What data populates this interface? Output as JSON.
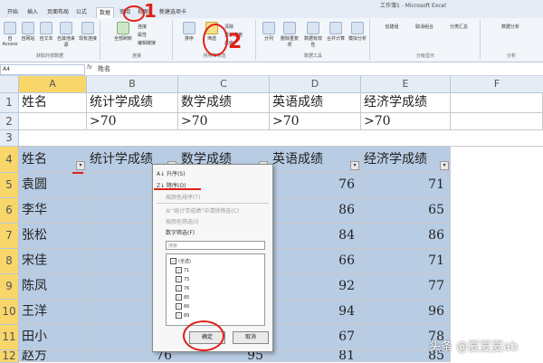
{
  "window": {
    "title": "工作簿1 - Microsoft Excel"
  },
  "tabs": [
    "开始",
    "插入",
    "页面布局",
    "公式",
    "数据",
    "审阅",
    "视图",
    "新建选项卡"
  ],
  "active_tab_index": 4,
  "ribbon": {
    "groups": [
      {
        "label": "获取外部数据",
        "buttons": [
          "自 Access",
          "自网站",
          "自文本",
          "自其他来源",
          "现有连接"
        ]
      },
      {
        "label": "连接",
        "buttons": [
          "全部刷新",
          "连接",
          "属性",
          "编辑链接"
        ]
      },
      {
        "label": "排序和筛选",
        "buttons": [
          "排序",
          "筛选",
          "清除",
          "重新应用",
          "高级"
        ]
      },
      {
        "label": "数据工具",
        "buttons": [
          "分列",
          "删除重复项",
          "数据有效性",
          "合并计算",
          "模拟分析"
        ]
      },
      {
        "label": "分级显示",
        "buttons": [
          "创建组",
          "取消组合",
          "分类汇总"
        ]
      },
      {
        "label": "分析",
        "buttons": [
          "数据分析"
        ]
      }
    ]
  },
  "formula_bar": {
    "name_box": "A4",
    "fx": "fx",
    "value": "姓名"
  },
  "columns": [
    "A",
    "B",
    "C",
    "D",
    "E",
    "F"
  ],
  "rows": [
    "1",
    "2",
    "3",
    "4",
    "5",
    "6",
    "7",
    "8",
    "9",
    "10",
    "11",
    "12"
  ],
  "criteria": {
    "headers": [
      "姓名",
      "统计学成绩",
      "数学成绩",
      "英语成绩",
      "经济学成绩"
    ],
    "values": [
      "",
      ">70",
      ">70",
      ">70",
      ">70"
    ]
  },
  "table": {
    "headers": [
      "姓名",
      "统计学成绩",
      "数学成绩",
      "英语成绩",
      "经济学成绩"
    ],
    "names": [
      "袁圆",
      "李华",
      "张松",
      "宋佳",
      "陈凤",
      "王洋",
      "田小",
      "赵方"
    ],
    "english": [
      "76",
      "86",
      "84",
      "66",
      "92",
      "94",
      "67",
      "81"
    ],
    "economics": [
      "71",
      "65",
      "86",
      "71",
      "77",
      "96",
      "78",
      "85"
    ],
    "stat_last": "76",
    "math_last": "95"
  },
  "filter_menu": {
    "items": [
      "升序(S)",
      "降序(O)",
      "按颜色排序(T)",
      "从“统计学成绩”中清除筛选(C)",
      "按颜色筛选(I)",
      "数字筛选(F)"
    ],
    "search_placeholder": "搜索",
    "checklist": [
      "(全选)",
      "71",
      "75",
      "76",
      "85",
      "86",
      "89"
    ],
    "ok_label": "确定",
    "cancel_label": "取消"
  },
  "annotations": {
    "mark_1": "1",
    "mark_2": "2"
  },
  "watermark": "头条 @夏夏夏ab"
}
